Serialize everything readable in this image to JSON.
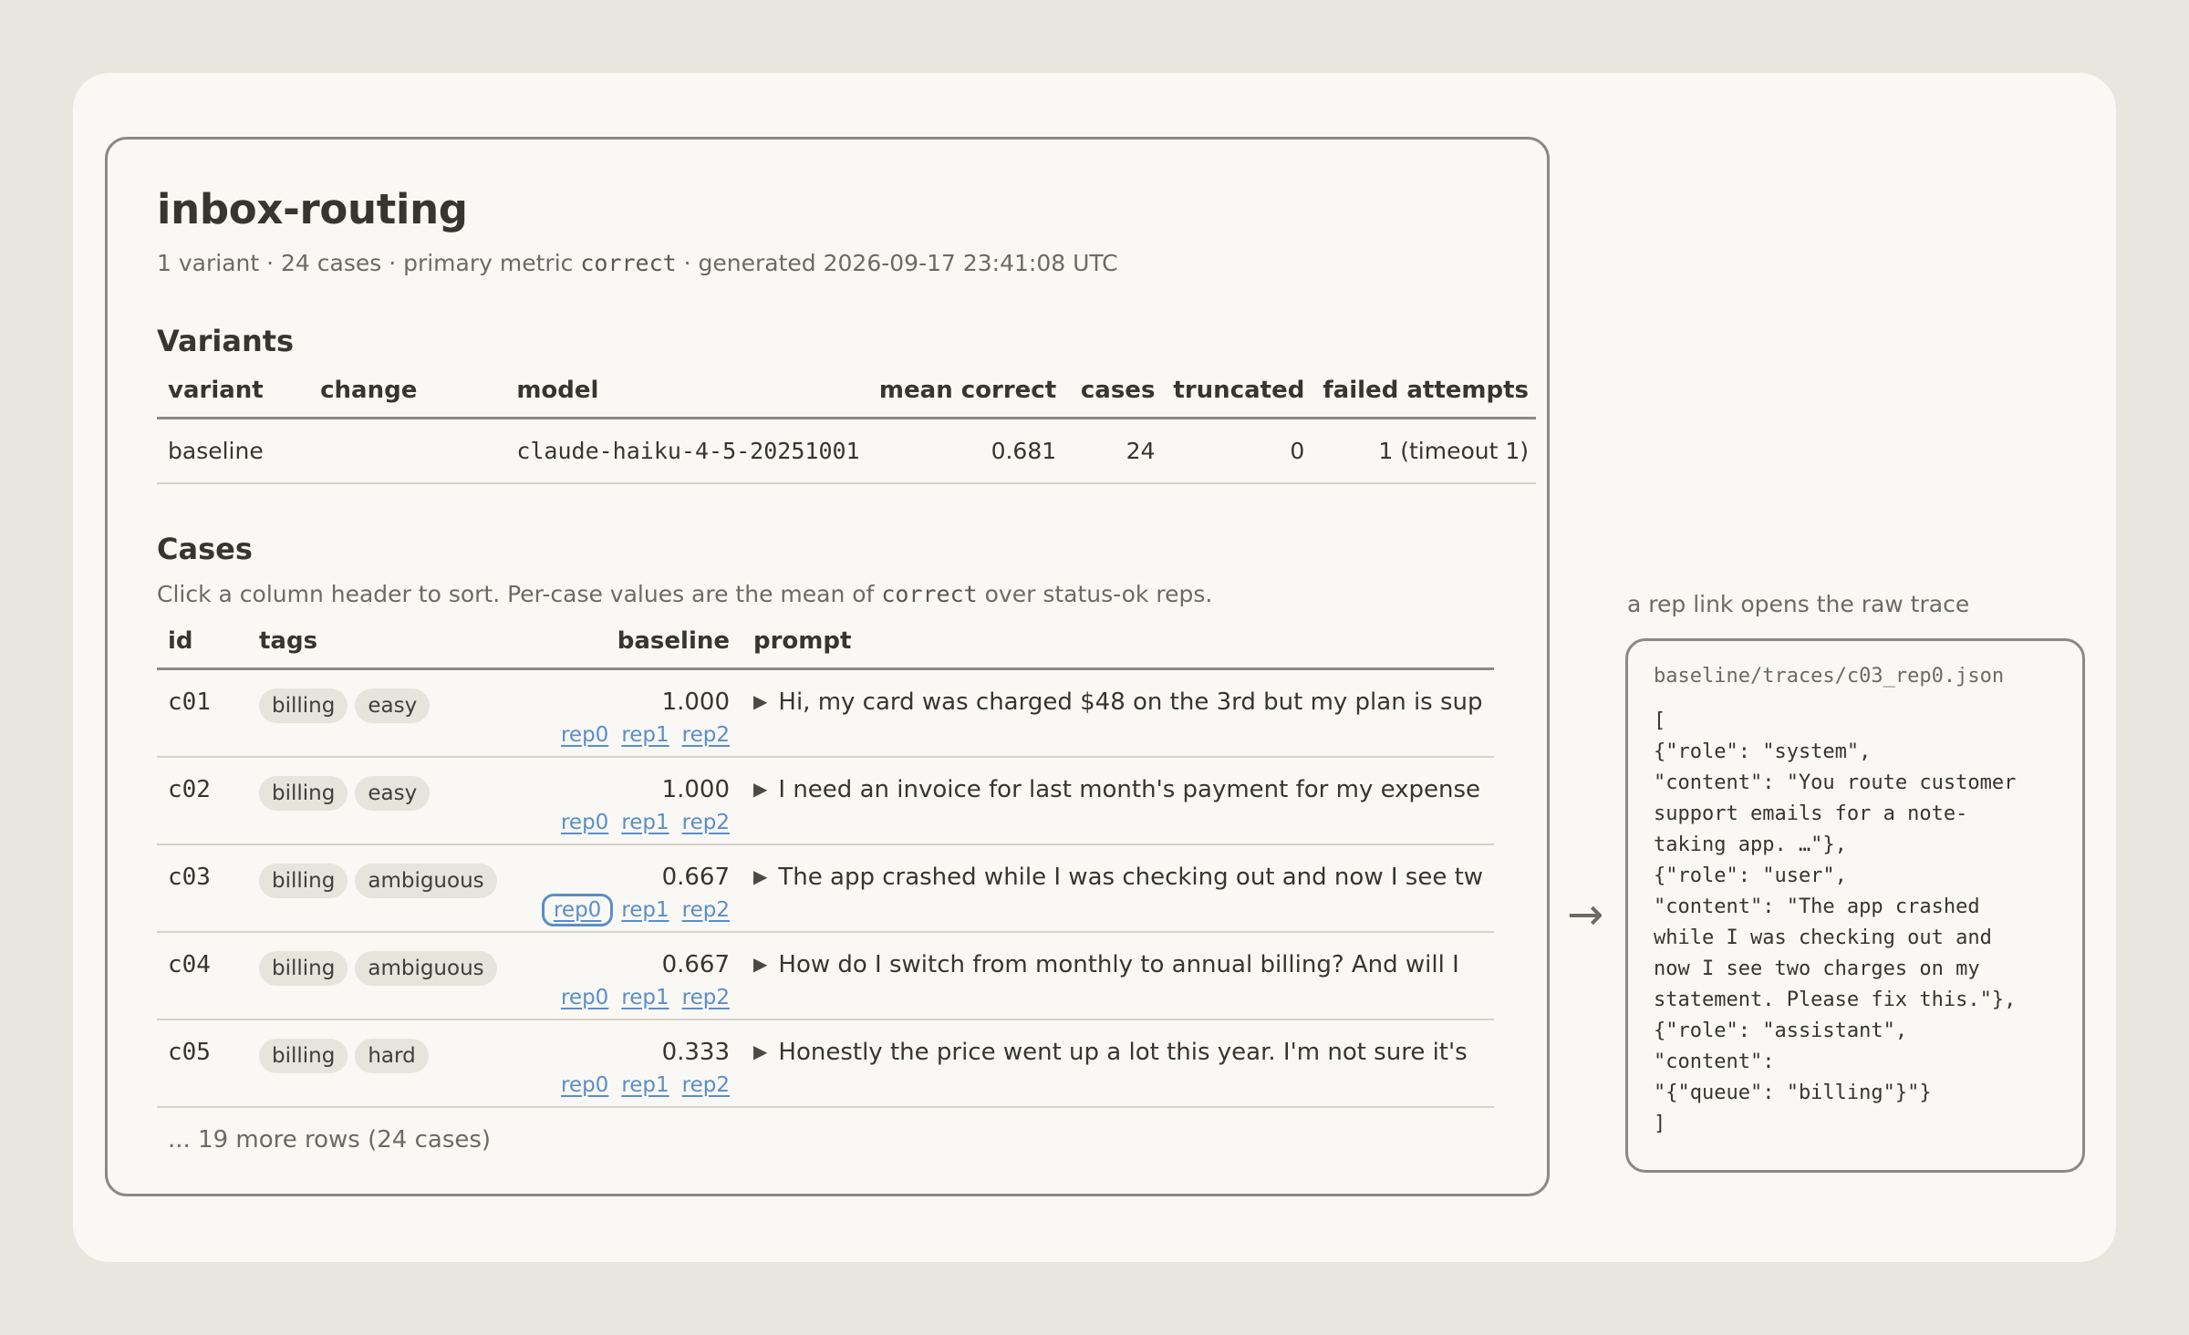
{
  "report": {
    "title": "inbox-routing",
    "subtitle_pre": "1 variant · 24 cases · primary metric ",
    "subtitle_metric": "correct",
    "subtitle_post": " · generated 2026-09-17 23:41:08 UTC"
  },
  "variants": {
    "heading": "Variants",
    "columns": [
      "variant",
      "change",
      "model",
      "mean correct",
      "cases",
      "truncated",
      "failed attempts"
    ],
    "rows": [
      {
        "variant": "baseline",
        "change": "",
        "model": "claude-haiku-4-5-20251001",
        "mean_correct": "0.681",
        "cases": "24",
        "truncated": "0",
        "failed_attempts": "1 (timeout 1)"
      }
    ]
  },
  "cases": {
    "heading": "Cases",
    "note_pre": "Click a column header to sort. Per-case values are the mean of ",
    "note_metric": "correct",
    "note_post": " over status-ok reps.",
    "columns": [
      "id",
      "tags",
      "baseline",
      "prompt"
    ],
    "rows": [
      {
        "id": "c01",
        "tags": [
          "billing",
          "easy"
        ],
        "score": "1.000",
        "reps": [
          "rep0",
          "rep1",
          "rep2"
        ],
        "prompt": "Hi, my card was charged $48 on the 3rd but my plan is sup"
      },
      {
        "id": "c02",
        "tags": [
          "billing",
          "easy"
        ],
        "score": "1.000",
        "reps": [
          "rep0",
          "rep1",
          "rep2"
        ],
        "prompt": "I need an invoice for last month's payment for my expense"
      },
      {
        "id": "c03",
        "tags": [
          "billing",
          "ambiguous"
        ],
        "score": "0.667",
        "reps": [
          "rep0",
          "rep1",
          "rep2"
        ],
        "prompt": "The app crashed while I was checking out and now I see tw"
      },
      {
        "id": "c04",
        "tags": [
          "billing",
          "ambiguous"
        ],
        "score": "0.667",
        "reps": [
          "rep0",
          "rep1",
          "rep2"
        ],
        "prompt": "How do I switch from monthly to annual billing? And will I"
      },
      {
        "id": "c05",
        "tags": [
          "billing",
          "hard"
        ],
        "score": "0.333",
        "reps": [
          "rep0",
          "rep1",
          "rep2"
        ],
        "prompt": "Honestly the price went up a lot this year. I'm not sure it's"
      }
    ],
    "more": "... 19 more rows (24 cases)"
  },
  "trace": {
    "caption": "a rep link opens the raw trace",
    "arrow": "→",
    "path": "baseline/traces/c03_rep0.json",
    "lines": [
      "[",
      "{\"role\": \"system\",",
      "\"content\": \"You route customer",
      "support emails for a note-",
      "taking app. …\"},",
      "{\"role\": \"user\",",
      "\"content\": \"The app crashed",
      "while I was checking out and",
      "now I see two charges on my",
      "statement. Please fix this.\"},",
      "{\"role\": \"assistant\",",
      "\"content\":",
      "\"{\"queue\": \"billing\"}\"}",
      "]"
    ]
  },
  "colors": {
    "background": "#e8e6df",
    "panel": "#f9f8f4",
    "link": "#5a8ec8",
    "tag_bg": "#e6e4dc"
  }
}
